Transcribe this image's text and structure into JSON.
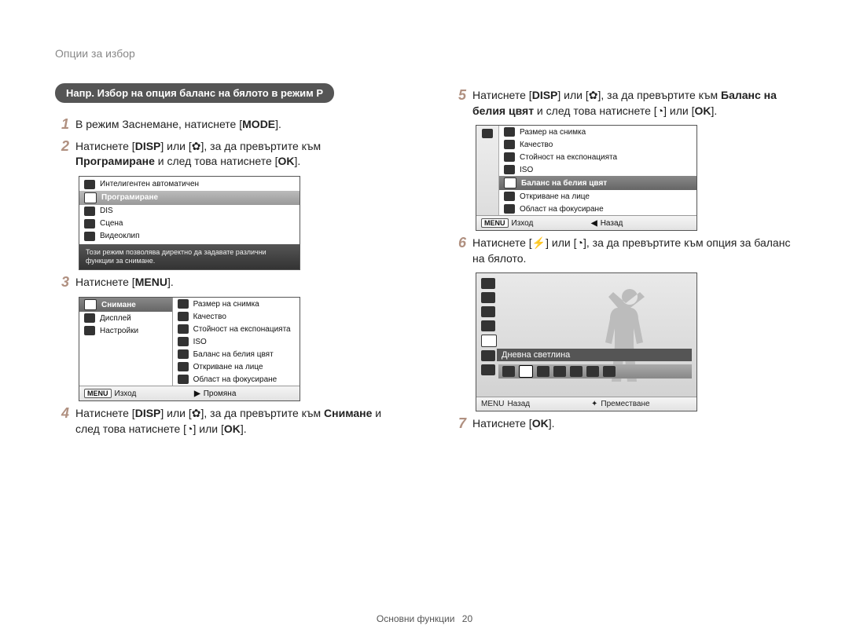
{
  "header": "Опции за избор",
  "example_pill": "Напр. Избор на опция баланс на бялото в режим P",
  "buttons": {
    "mode": "MODE",
    "disp": "DISP",
    "menu": "MENU",
    "ok": "OK"
  },
  "steps": {
    "s1": {
      "num": "1",
      "text_a": "В режим Заснемане, натиснете [",
      "text_b": "]."
    },
    "s2": {
      "num": "2",
      "text_a": "Натиснете [",
      "text_b": "] или [",
      "text_c": "], за да превъртите към ",
      "bold": "Програмиране",
      "text_d": " и след това натиснете [",
      "text_e": "]."
    },
    "s3": {
      "num": "3",
      "text_a": "Натиснете [",
      "text_b": "]."
    },
    "s4": {
      "num": "4",
      "text_a": "Натиснете [",
      "text_b": "] или [",
      "text_c": "], за да превъртите към ",
      "bold": "Снимане",
      "text_d": " и след това натиснете [",
      "text_e": "] или [",
      "text_f": "]."
    },
    "s5": {
      "num": "5",
      "text_a": "Натиснете [",
      "text_b": "] или [",
      "text_c": "], за да превъртите към ",
      "bold": "Баланс на белия цвят",
      "text_d": " и след това натиснете [",
      "text_e": "] или [",
      "text_f": "]."
    },
    "s6": {
      "num": "6",
      "text_a": "Натиснете [",
      "text_b": "] или [",
      "text_c": "], за да превъртите към опция за баланс на бялото."
    },
    "s7": {
      "num": "7",
      "text_a": "Натиснете [",
      "text_b": "]."
    }
  },
  "lcd1": {
    "items": [
      "Интелигентен автоматичен",
      "Програмиране",
      "DIS",
      "Сцена",
      "Видеоклип"
    ],
    "desc": "Този режим позволява директно да задавате различни функции за снимане."
  },
  "lcd2": {
    "left": [
      "Снимане",
      "Дисплей",
      "Настройки"
    ],
    "right": [
      "Размер на снимка",
      "Качество",
      "Стойност на експонацията",
      "ISO",
      "Баланс на белия цвят",
      "Откриване на лице",
      "Област на фокусиране"
    ],
    "footer_left": "Изход",
    "footer_right": "Промяна"
  },
  "lcd3": {
    "right": [
      "Размер на снимка",
      "Качество",
      "Стойност на експонацията",
      "ISO",
      "Баланс на белия цвят",
      "Откриване на лице",
      "Област на фокусиране"
    ],
    "footer_left": "Изход",
    "footer_right": "Назад"
  },
  "wb": {
    "label": "Дневна светлина",
    "footer_left": "Назад",
    "footer_right": "Преместване"
  },
  "footer": {
    "section": "Основни функции",
    "page": "20"
  }
}
